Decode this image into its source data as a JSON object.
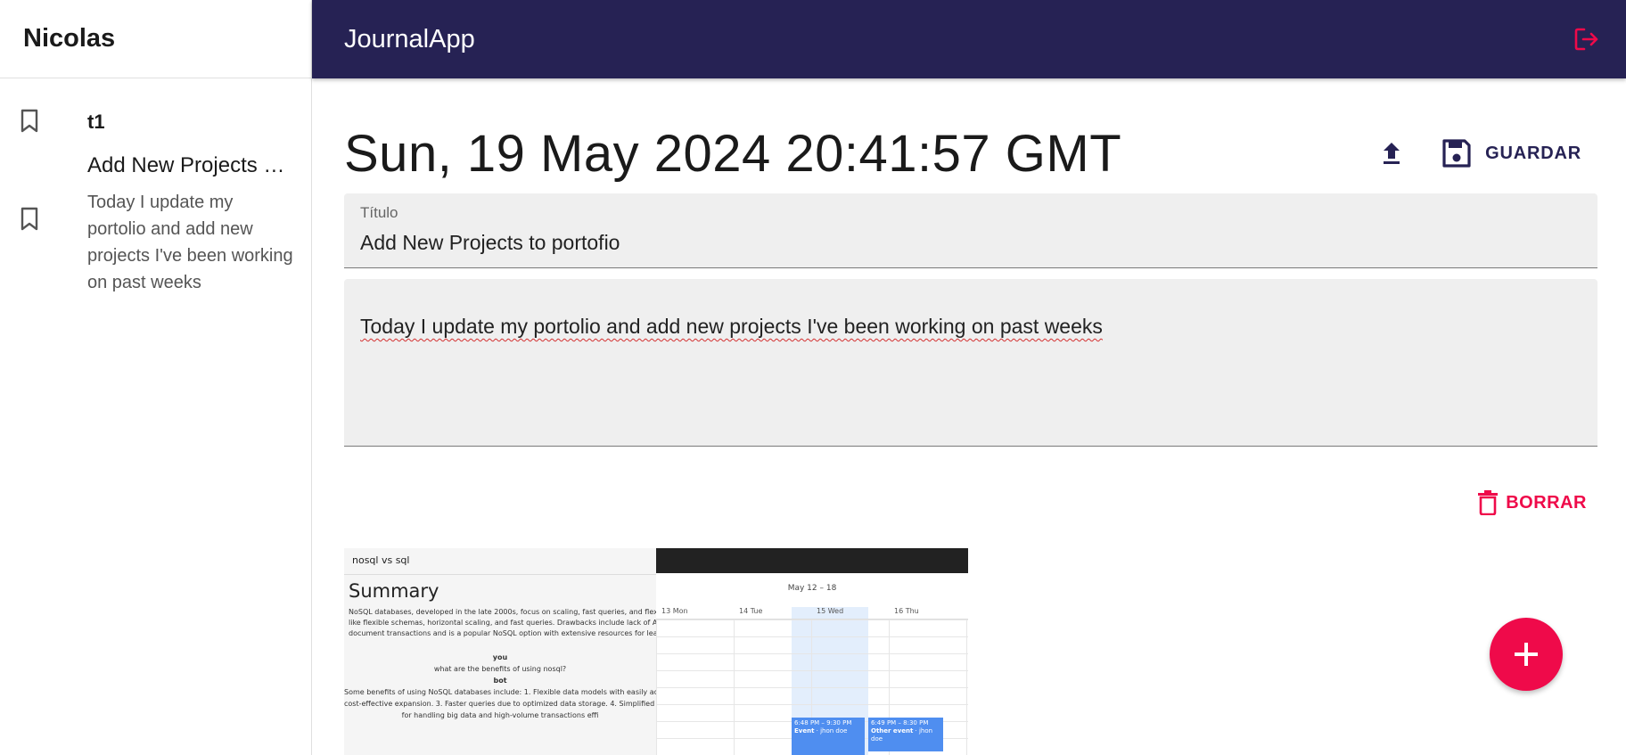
{
  "sidebar": {
    "user_name": "Nicolas",
    "entries": [
      {
        "title": "t1",
        "body": ""
      },
      {
        "title": "Add New Projects to portofio",
        "body": "Today I update my portolio and add new projects I've been working on past weeks"
      }
    ]
  },
  "appbar": {
    "title": "JournalApp"
  },
  "note": {
    "date": "Sun, 19 May 2024 20:41:57 GMT",
    "save_label": "GUARDAR",
    "title_label": "Título",
    "title_value": "Add New Projects to portofio",
    "body_value": "Today I update my portolio and add new projects I've been working on past weeks",
    "delete_label": "BORRAR"
  },
  "images": {
    "image1": {
      "header": "nosql vs sql",
      "summary_heading": "Summary",
      "text_lines": [
        "NoSQL databases, developed in the late 2000s, focus on scaling, fast queries, and flexibi",
        "like flexible schemas, horizontal scaling, and fast queries. Drawbacks include lack of ACID",
        "document transactions and is a popular NoSQL option with extensive resources for learn"
      ],
      "you_label": "you",
      "question": "what are the benefits of using nosql?",
      "bot_label": "bot",
      "answer_lines": [
        "Some benefits of using NoSQL databases include: 1. Flexible data models with easily ada",
        "cost-effective expansion. 3. Faster queries due to optimized data storage. 4. Simplified p",
        "for handling big data and high-volume transactions effi"
      ]
    },
    "image2": {
      "week_range": "May 12 – 18",
      "days": [
        "13 Mon",
        "14 Tue",
        "15 Wed",
        "16 Thu"
      ],
      "event1": {
        "time": "6:48 PM – 9:30 PM",
        "title": "Event",
        "who": " · jhon doe"
      },
      "event2": {
        "time": "6:49 PM – 8:30 PM",
        "title": "Other event",
        "who": " · jhon doe"
      }
    }
  },
  "colors": {
    "appbar": "#262254",
    "accent": "#ef0a4a",
    "primary": "#262254"
  },
  "icons": {
    "bookmark": "bookmark-icon",
    "logout": "logout-icon",
    "upload": "upload-icon",
    "save": "save-icon",
    "delete": "trash-icon",
    "add": "plus-icon"
  }
}
